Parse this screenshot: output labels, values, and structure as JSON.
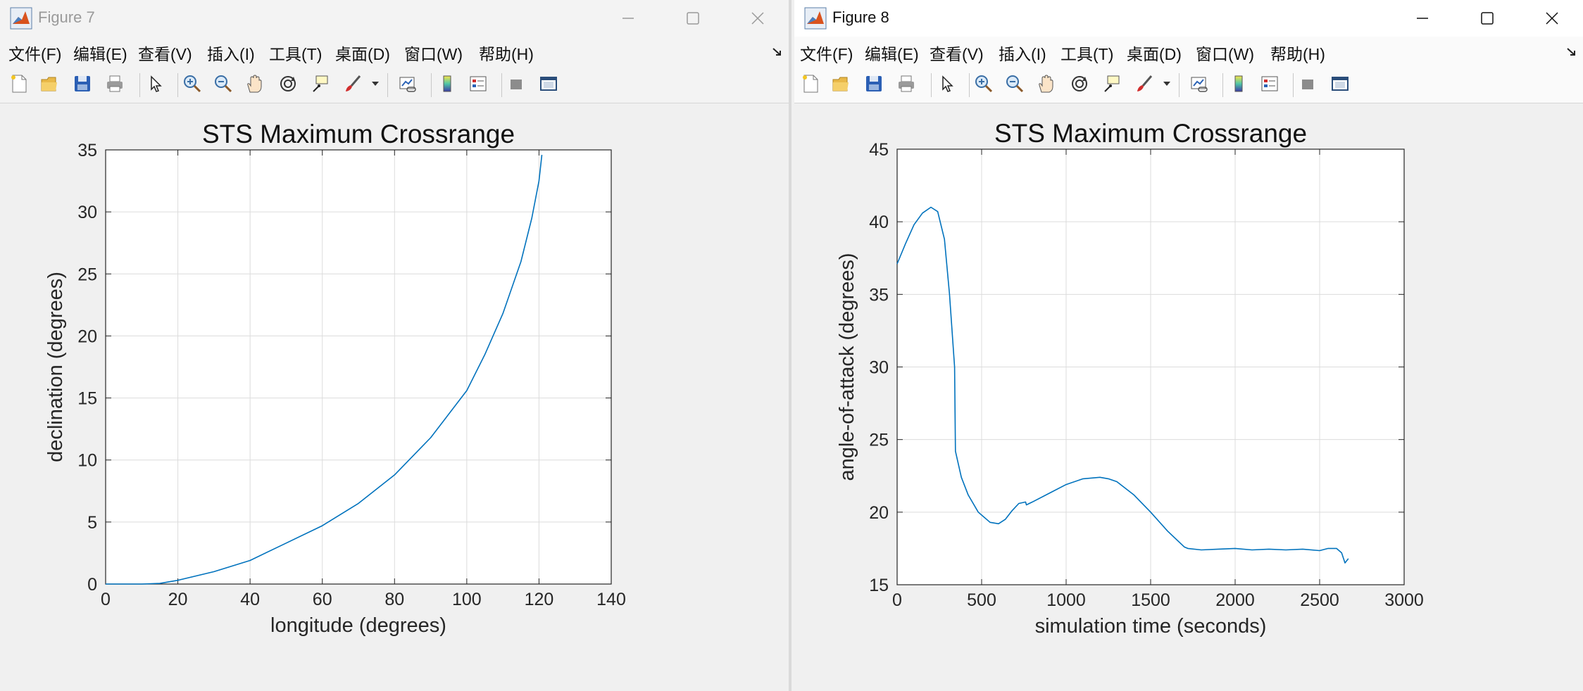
{
  "windows": [
    {
      "title": "Figure 7",
      "menu": [
        "文件(F)",
        "编辑(E)",
        "查看(V)",
        "插入(I)",
        "工具(T)",
        "桌面(D)",
        "窗口(W)",
        "帮助(H)"
      ],
      "chart_data": {
        "type": "line",
        "title": "STS Maximum Crossrange",
        "xlabel": "longitude (degrees)",
        "ylabel": "declination (degrees)",
        "xlim": [
          0,
          140
        ],
        "ylim": [
          0,
          35
        ],
        "xticks": [
          0,
          20,
          40,
          60,
          80,
          100,
          120,
          140
        ],
        "yticks": [
          0,
          5,
          10,
          15,
          20,
          25,
          30,
          35
        ],
        "grid": true,
        "color": "#0072bd",
        "series": [
          {
            "x": [
              0,
              10,
              15,
              20,
              30,
              40,
              50,
              60,
              70,
              80,
              90,
              100,
              105,
              110,
              115,
              118,
              120,
              120.8
            ],
            "y": [
              0,
              0,
              0.05,
              0.3,
              1.0,
              1.9,
              3.3,
              4.7,
              6.5,
              8.8,
              11.8,
              15.6,
              18.5,
              21.8,
              26.0,
              29.5,
              32.5,
              34.6
            ]
          }
        ]
      }
    },
    {
      "title": "Figure 8",
      "menu": [
        "文件(F)",
        "编辑(E)",
        "查看(V)",
        "插入(I)",
        "工具(T)",
        "桌面(D)",
        "窗口(W)",
        "帮助(H)"
      ],
      "chart_data": {
        "type": "line",
        "title": "STS Maximum Crossrange",
        "xlabel": "simulation time (seconds)",
        "ylabel": "angle-of-attack (degrees)",
        "xlim": [
          0,
          3000
        ],
        "ylim": [
          15,
          45
        ],
        "xticks": [
          0,
          500,
          1000,
          1500,
          2000,
          2500,
          3000
        ],
        "yticks": [
          15,
          20,
          25,
          30,
          35,
          40,
          45
        ],
        "grid": true,
        "color": "#0072bd",
        "series": [
          {
            "x": [
              0,
              50,
              100,
              150,
              200,
              240,
              280,
              310,
              340,
              345,
              380,
              420,
              480,
              550,
              600,
              640,
              680,
              720,
              760,
              765,
              800,
              900,
              1000,
              1100,
              1200,
              1250,
              1300,
              1400,
              1500,
              1600,
              1700,
              1720,
              1800,
              1900,
              2000,
              2100,
              2200,
              2300,
              2400,
              2500,
              2550,
              2600,
              2630,
              2650,
              2670
            ],
            "y": [
              37.1,
              38.5,
              39.8,
              40.6,
              41.0,
              40.7,
              38.8,
              35.0,
              30.0,
              24.2,
              22.4,
              21.2,
              20.0,
              19.3,
              19.2,
              19.5,
              20.1,
              20.6,
              20.7,
              20.5,
              20.7,
              21.3,
              21.9,
              22.3,
              22.4,
              22.3,
              22.1,
              21.2,
              20.0,
              18.7,
              17.6,
              17.5,
              17.4,
              17.45,
              17.5,
              17.4,
              17.45,
              17.4,
              17.45,
              17.35,
              17.5,
              17.5,
              17.2,
              16.5,
              16.8
            ]
          }
        ]
      }
    }
  ]
}
